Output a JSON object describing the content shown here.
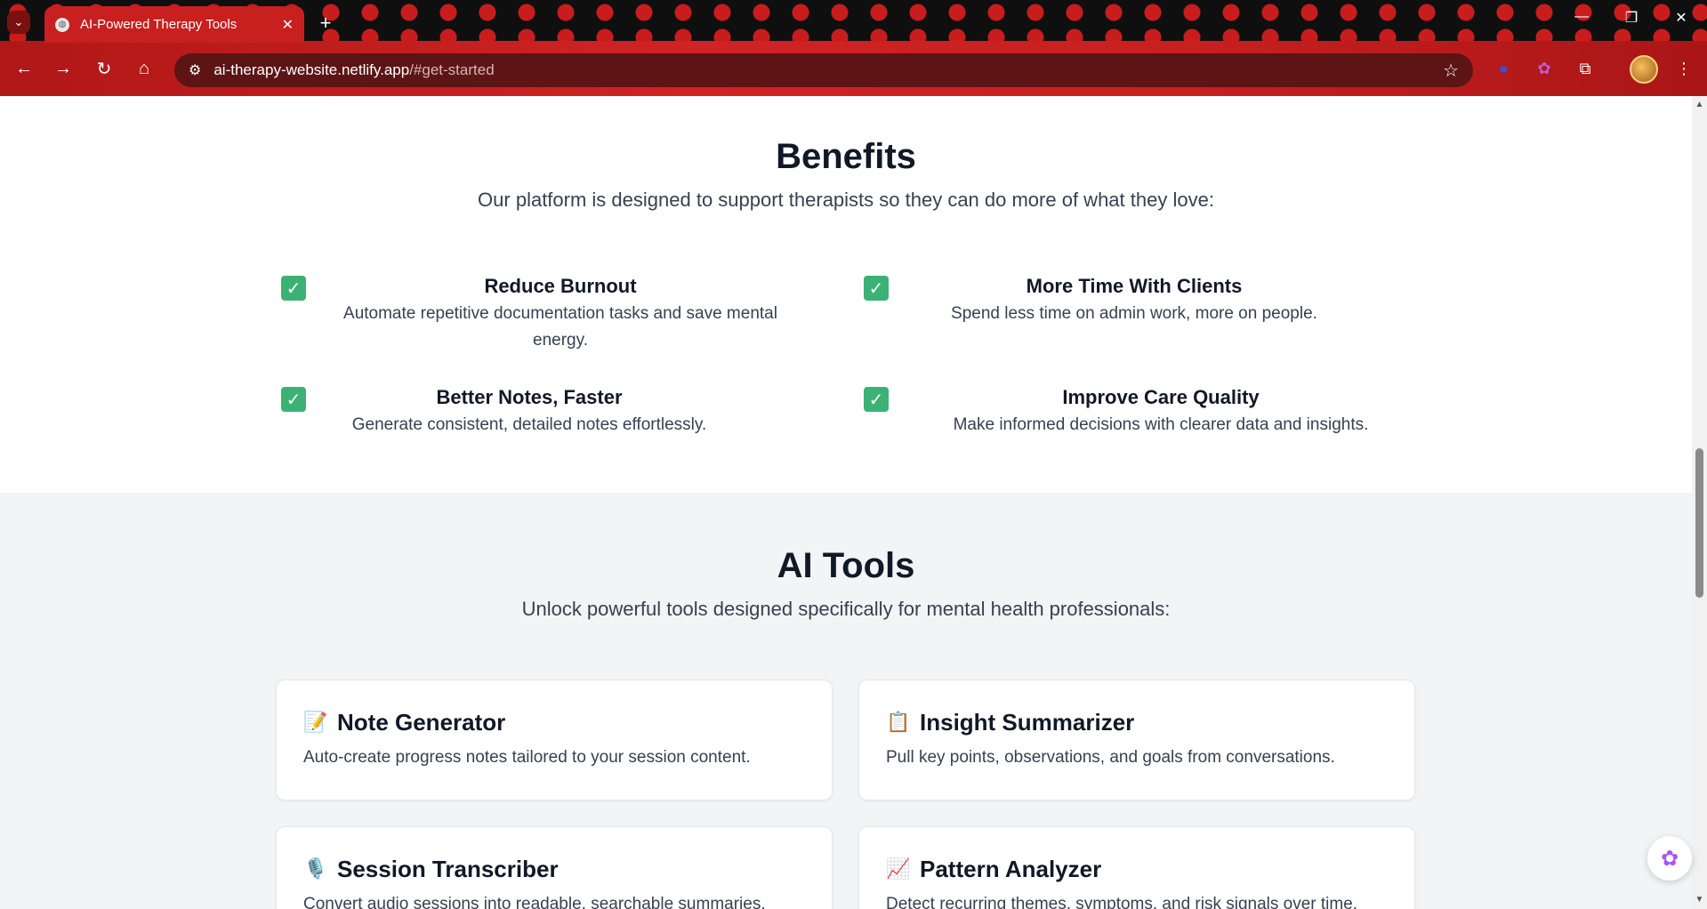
{
  "browser": {
    "tab_title": "AI-Powered Therapy Tools",
    "url_host": "ai-therapy-website.netlify.app",
    "url_path": "/#get-started",
    "icons": [
      "tab-search-icon",
      "back-icon",
      "forward-icon",
      "reload-icon",
      "home-icon",
      "site-info-icon",
      "bookmark-star-icon",
      "extensions-icon",
      "menu-icon"
    ]
  },
  "benefits": {
    "title": "Benefits",
    "subtitle": "Our platform is designed to support therapists so they can do more of what they love:",
    "items": [
      {
        "title": "Reduce Burnout",
        "desc": "Automate repetitive documentation tasks and save mental energy."
      },
      {
        "title": "More Time With Clients",
        "desc": "Spend less time on admin work, more on people."
      },
      {
        "title": "Better Notes, Faster",
        "desc": "Generate consistent, detailed notes effortlessly."
      },
      {
        "title": "Improve Care Quality",
        "desc": "Make informed decisions with clearer data and insights."
      }
    ]
  },
  "tools": {
    "title": "AI Tools",
    "subtitle": "Unlock powerful tools designed specifically for mental health professionals:",
    "items": [
      {
        "emoji": "📝",
        "title": "Note Generator",
        "desc": "Auto-create progress notes tailored to your session content."
      },
      {
        "emoji": "📋",
        "title": "Insight Summarizer",
        "desc": "Pull key points, observations, and goals from conversations."
      },
      {
        "emoji": "🎙️",
        "title": "Session Transcriber",
        "desc": "Convert audio sessions into readable, searchable summaries."
      },
      {
        "emoji": "📈",
        "title": "Pattern Analyzer",
        "desc": "Detect recurring themes, symptoms, and risk signals over time."
      }
    ]
  },
  "colors": {
    "check_green": "#3bb273",
    "section_gray": "#f3f4f6",
    "browser_red": "#c81f1f"
  }
}
